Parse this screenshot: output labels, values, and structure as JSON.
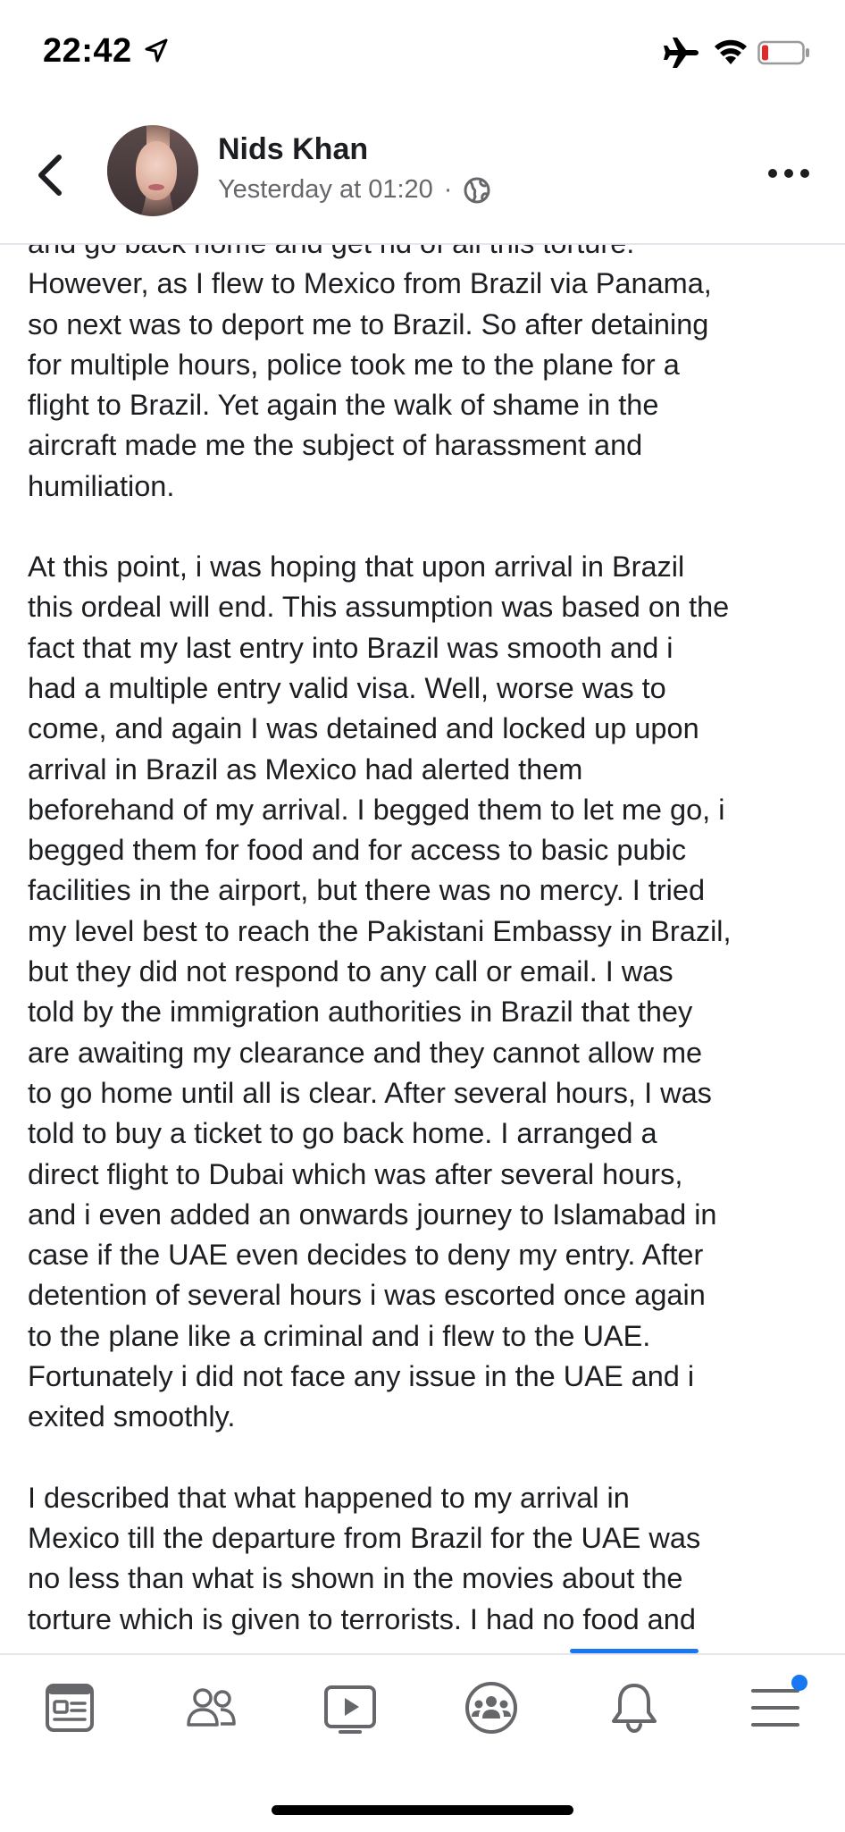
{
  "status_bar": {
    "time": "22:42",
    "icons": [
      "location-arrow-icon",
      "airplane-mode-icon",
      "wifi-icon",
      "battery-low-icon"
    ],
    "battery_color": "#e0292b"
  },
  "post_header": {
    "back_icon": "chevron-left-icon",
    "author_name": "Nids Khan",
    "timestamp": "Yesterday at 01:20",
    "separator": "·",
    "privacy_icon": "globe-icon",
    "more_icon": "ellipsis-icon"
  },
  "post": {
    "paragraphs": [
      {
        "lines": [
          "and go back home and get rid of all this torture.",
          "However, as I flew to Mexico from Brazil via Panama,",
          "so next was to deport me to Brazil. So after detaining",
          "for multiple hours, police took me to the plane for a",
          "flight to Brazil. Yet again the walk of shame in the",
          "aircraft made me the subject of harassment and",
          "humiliation."
        ]
      },
      {
        "lines": [
          "At this point, i was hoping that upon arrival in Brazil",
          "this ordeal will end. This assumption was based on the",
          "fact that my last entry into Brazil was smooth and i",
          "had a multiple entry valid visa. Well, worse was to",
          "come, and again I  was detained and locked up upon",
          "arrival in Brazil as Mexico had alerted them",
          "beforehand of my arrival. I begged them to let me go, i",
          "begged them for food and for access to basic pubic",
          "facilities in the airport, but there was no mercy. I tried",
          "my level best to reach the Pakistani Embassy in Brazil,",
          "but they did not respond to any call or email. I  was",
          "told by the immigration authorities in Brazil that they",
          "are awaiting my clearance and they cannot allow me",
          "to go home until all is clear. After several hours, I was",
          "told to buy a ticket to go back home. I arranged a",
          "direct flight to Dubai which was after several hours,",
          "and i even added an onwards journey to Islamabad in",
          "case if the UAE even decides to deny my entry. After",
          "detention of several hours i was escorted once again",
          "to the plane like a criminal and i flew to the UAE.",
          "Fortunately i did not face any issue in the UAE and i",
          "exited smoothly."
        ]
      },
      {
        "lines": [
          "I described that what happened to my arrival in",
          "Mexico till the departure from Brazil for the UAE was",
          "no less than what is shown in the movies about the",
          "torture which is given to terrorists. I had no food and"
        ]
      }
    ]
  },
  "tab_bar": {
    "tabs": [
      {
        "name": "news-feed",
        "icon": "news-feed-icon"
      },
      {
        "name": "friends",
        "icon": "friends-icon"
      },
      {
        "name": "watch",
        "icon": "video-play-icon"
      },
      {
        "name": "groups",
        "icon": "groups-icon"
      },
      {
        "name": "notifications",
        "icon": "bell-icon"
      },
      {
        "name": "menu",
        "icon": "hamburger-menu-icon"
      }
    ],
    "accent_color": "#1877f2"
  }
}
